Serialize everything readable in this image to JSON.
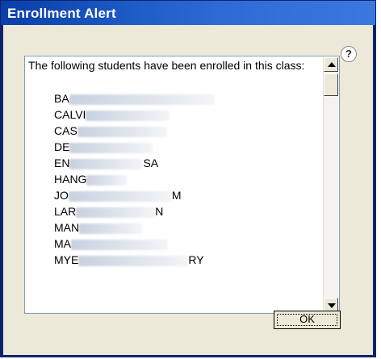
{
  "window": {
    "title": "Enrollment Alert"
  },
  "help": {
    "label": "?"
  },
  "list": {
    "intro": "The following students have been enrolled in this class:",
    "students": [
      {
        "visible": "BA",
        "trail": ""
      },
      {
        "visible": "CALVI",
        "trail": ""
      },
      {
        "visible": "CAS",
        "trail": ""
      },
      {
        "visible": "DE",
        "trail": ""
      },
      {
        "visible": "EN",
        "trail": "SA"
      },
      {
        "visible": "HANG",
        "trail": ""
      },
      {
        "visible": "JO",
        "trail": "M"
      },
      {
        "visible": "LAR",
        "trail": "N"
      },
      {
        "visible": "MAN",
        "trail": ""
      },
      {
        "visible": "MA",
        "trail": ""
      },
      {
        "visible": "MYE",
        "trail": "RY"
      }
    ]
  },
  "buttons": {
    "ok": "OK"
  },
  "icons": {
    "help": "question-mark-icon",
    "up": "scroll-up-arrow-icon",
    "down": "scroll-down-arrow-icon"
  }
}
